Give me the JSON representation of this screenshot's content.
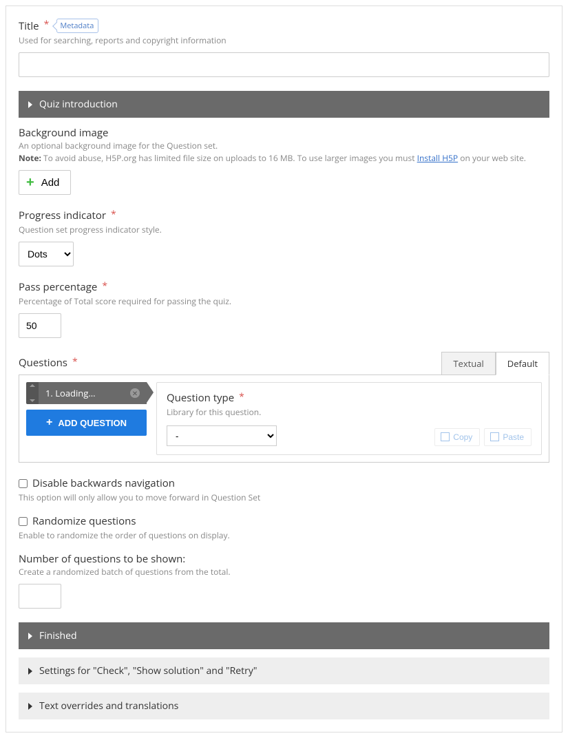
{
  "title": {
    "label": "Title",
    "badge": "Metadata",
    "description": "Used for searching, reports and copyright information",
    "value": ""
  },
  "quiz_intro": {
    "label": "Quiz introduction"
  },
  "background_image": {
    "label": "Background image",
    "desc": "An optional background image for the Question set.",
    "note_label": "Note:",
    "note_text": " To avoid abuse, H5P.org has limited file size on uploads to 16 MB. To use larger images you must ",
    "link_text": "Install H5P",
    "note_tail": " on your web site.",
    "add_button": "Add"
  },
  "progress": {
    "label": "Progress indicator",
    "desc": "Question set progress indicator style.",
    "value": "Dots"
  },
  "pass": {
    "label": "Pass percentage",
    "desc": "Percentage of Total score required for passing the quiz.",
    "value": "50"
  },
  "questions": {
    "label": "Questions",
    "tab_textual": "Textual",
    "tab_default": "Default",
    "item_label": "1. Loading...",
    "add_button": "ADD QUESTION",
    "qtype_label": "Question type",
    "qtype_desc": "Library for this question.",
    "qtype_value": "-",
    "copy": "Copy",
    "paste": "Paste"
  },
  "disable_back": {
    "label": "Disable backwards navigation",
    "desc": "This option will only allow you to move forward in Question Set"
  },
  "randomize": {
    "label": "Randomize questions",
    "desc": "Enable to randomize the order of questions on display."
  },
  "num_shown": {
    "label": "Number of questions to be shown:",
    "desc": "Create a randomized batch of questions from the total.",
    "value": ""
  },
  "finished": {
    "label": "Finished"
  },
  "settings_check": {
    "label": "Settings for \"Check\", \"Show solution\" and \"Retry\""
  },
  "text_overrides": {
    "label": "Text overrides and translations"
  }
}
